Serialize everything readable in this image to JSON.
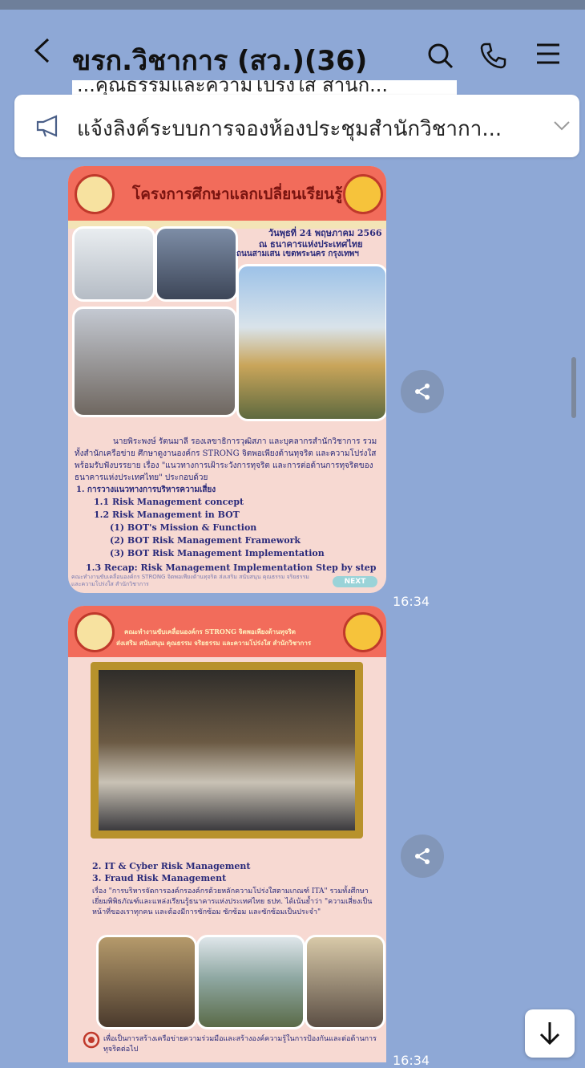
{
  "header": {
    "title": "ขรก.วิชาการ (สว.)(36)",
    "back_icon": "chevron-left-icon",
    "search_icon": "search-icon",
    "call_icon": "phone-icon",
    "menu_icon": "menu-icon",
    "cut_text": "...คุณธรรมและความโปร่งใส สำนัก..."
  },
  "announcement": {
    "icon": "megaphone-icon",
    "text": "แจ้งลิงค์ระบบการจองห้องประชุมสำนักวิชากา...",
    "expand_icon": "chevron-down-icon"
  },
  "messages": [
    {
      "time": "16:34",
      "poster": {
        "heading": "โครงการศึกษาแลกเปลี่ยนเรียนรู้",
        "date_lines": [
          "วันพุธที่ 24 พฤษภาคม 2566",
          "ณ ธนาคารแห่งประเทศไทย",
          "ถนนสามเสน เขตพระนคร กรุงเทพฯ"
        ],
        "body_intro": "นายพิระพงษ์ รัตนมาลี รองเลขาธิการวุฒิสภา และบุคลากรสำนักวิชาการ รวมทั้งสำนักเครือข่าย ศึกษาดูงานองค์กร STRONG จิตพอเพียงต้านทุจริต และความโปร่งใส พร้อมรับฟังบรรยาย เรื่อง \"แนวทางการเฝ้าระวังการทุจริต และการต่อต้านการทุจริตของธนาคารแห่งประเทศไทย\" ประกอบด้วย",
        "items": [
          "1. การวางแนวทางการบริหารความเสี่ยง",
          "1.1 Risk Management concept",
          "1.2 Risk Management in BOT",
          "(1) BOT's Mission & Function",
          "(2) BOT Risk Management Framework",
          "(3) BOT Risk Management Implementation",
          "1.3 Recap: Risk Management Implementation Step by step"
        ],
        "footer": "คณะทำงานขับเคลื่อนองค์กร STRONG จิตพอเพียงต้านทุจริต ส่งเสริม สนับสนุน คุณธรรม จริยธรรม และความโปร่งใส สำนักวิชาการ",
        "next_label": "NEXT"
      }
    },
    {
      "time": "16:34",
      "poster": {
        "heading_lines": [
          "คณะทำงานขับเคลื่อนองค์กร STRONG จิตพอเพียงต้านทุจริต",
          "ส่งเสริม สนับสนุน คุณธรรม จริยธรรม และความโปร่งใส สำนักวิชาการ"
        ],
        "items": [
          "2. IT & Cyber Risk Management",
          "3. Fraud Risk Management"
        ],
        "body": "เรื่อง \"การบริหารจัดการองค์กรองค์กรด้วยหลักความโปร่งใสตามเกณฑ์ ITA\" รวมทั้งศึกษาเยี่ยมพิพิธภัณฑ์และแหล่งเรียนรู้ธนาคารแห่งประเทศไทย ธปท. ได้เน้นย้ำว่า \"ความเสี่ยงเป็นหน้าที่ของเราทุกคน และต้องมีการซักซ้อม ซักซ้อม และซักซ้อมเป็นประจำ\"",
        "closing": "เพื่อเป็นการสร้างเครือข่ายความร่วมมือและสร้างองค์ความรู้ในการป้องกันและต่อต้านการทุจริตต่อไป"
      }
    }
  ],
  "share_icon": "share-icon",
  "scroll_down_icon": "arrow-down-icon",
  "colors": {
    "chat_background": "#8ea8d6",
    "poster_header": "#f26c5b",
    "poster_body": "#f7d9d2",
    "poster_text": "#2a2a7a"
  }
}
